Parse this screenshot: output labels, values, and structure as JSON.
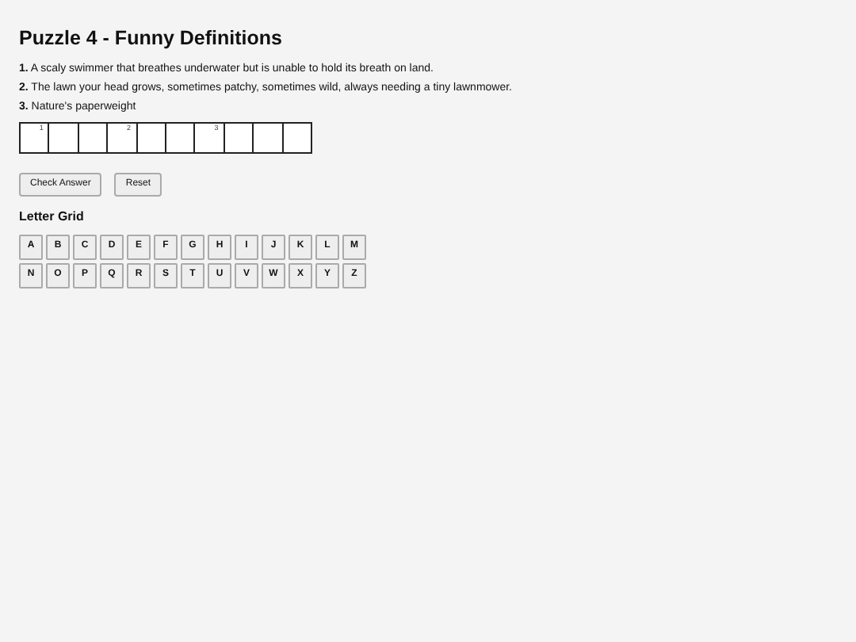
{
  "title": "Puzzle 4 - Funny Definitions",
  "clues": [
    "**1.** A scaly swimmer that breathes underwater but is unable to hold its breath on land.",
    "**2.** The lawn your head grows, sometimes patchy, sometimes wild, always needing a tiny lawnmower.",
    "**3.** Nature's paperweight"
  ],
  "cells": [
    {
      "number": "1"
    },
    {},
    {},
    {
      "number": "2"
    },
    {},
    {},
    {
      "number": "3"
    },
    {},
    {},
    {}
  ],
  "buttons": [
    "Check Answer",
    "Reset"
  ],
  "letter_grid": {
    "title": "Letter Grid",
    "letters": [
      "A",
      "B",
      "C",
      "D",
      "E",
      "F",
      "G",
      "H",
      "I",
      "J",
      "K",
      "L",
      "M",
      "N",
      "O",
      "P",
      "Q",
      "R",
      "S",
      "T",
      "U",
      "V",
      "W",
      "X",
      "Y",
      "Z"
    ]
  }
}
